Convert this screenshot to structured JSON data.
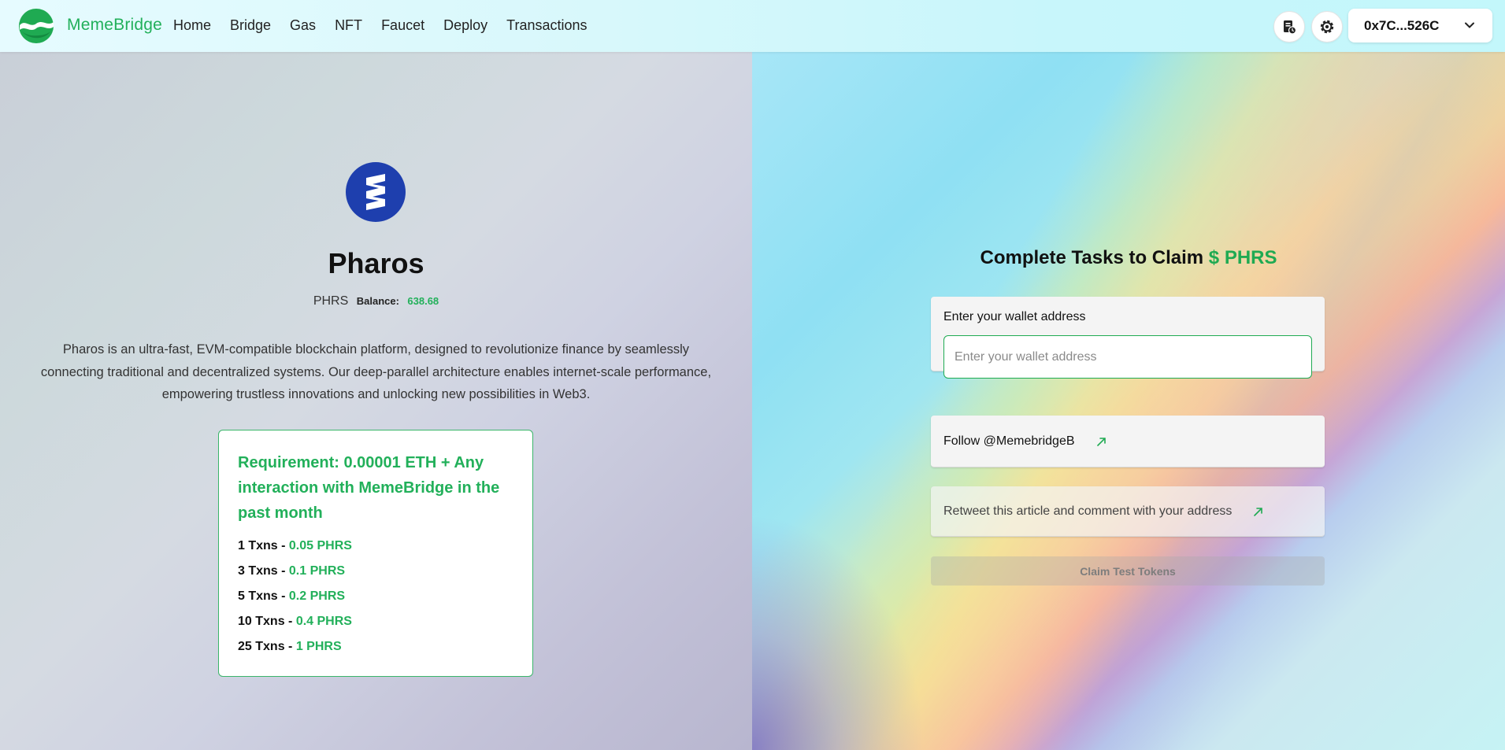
{
  "header": {
    "brand": "MemeBridge",
    "nav": [
      "Home",
      "Bridge",
      "Gas",
      "NFT",
      "Faucet",
      "Deploy",
      "Transactions"
    ],
    "wallet_address": "0x7C...526C"
  },
  "token": {
    "name": "Pharos",
    "symbol": "PHRS",
    "balance_label": "Balance:",
    "balance_value": "638.68",
    "description": "Pharos is an ultra-fast, EVM-compatible blockchain platform, designed to revolutionize finance by seamlessly connecting traditional and decentralized systems. Our deep-parallel architecture enables internet-scale performance, empowering trustless innovations and unlocking new possibilities in Web3."
  },
  "requirement": {
    "title": "Requirement: 0.00001 ETH + Any interaction with MemeBridge in the past month",
    "rows": [
      {
        "txns": "1 Txns - ",
        "reward": "0.05 PHRS"
      },
      {
        "txns": "3 Txns - ",
        "reward": "0.1 PHRS"
      },
      {
        "txns": "5 Txns - ",
        "reward": "0.2 PHRS"
      },
      {
        "txns": "10 Txns - ",
        "reward": "0.4 PHRS"
      },
      {
        "txns": "25 Txns - ",
        "reward": "1 PHRS"
      }
    ]
  },
  "claim": {
    "title_prefix": "Complete Tasks to Claim ",
    "title_token": "$ PHRS",
    "wallet_label": "Enter your wallet address",
    "wallet_placeholder": "Enter your wallet address",
    "wallet_value": "",
    "follow_text": "Follow @MemebridgeB",
    "retweet_text": "Retweet this article and comment with your address",
    "button_label": "Claim Test Tokens"
  },
  "colors": {
    "accent": "#22b05a",
    "token_blue": "#1e3fae"
  },
  "icons": [
    "memebridge-logo-icon",
    "history-icon",
    "settings-gear-icon",
    "chevron-down-icon",
    "pharos-logo-icon",
    "external-arrow-icon"
  ]
}
